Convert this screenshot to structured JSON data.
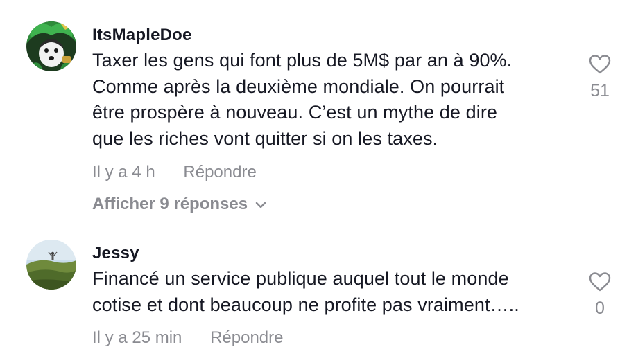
{
  "comments": [
    {
      "username": "ItsMapleDoe",
      "text_lines": [
        "Taxer les gens qui font plus de 5M$ par an à 90%.",
        "Comme après la deuxième mondiale. On pourrait",
        "être prospère à nouveau. C’est un mythe de dire",
        "que les riches vont quitter si on les taxes."
      ],
      "time": "Il y a 4 h",
      "reply_label": "Répondre",
      "view_replies_label": "Afficher 9 réponses",
      "like_count": "51"
    },
    {
      "username": "Jessy",
      "text_lines": [
        "Financé un service publique auquel tout le monde",
        "cotise et dont beaucoup ne profite pas vraiment….."
      ],
      "time": "Il y a 25 min",
      "reply_label": "Répondre",
      "like_count": "0"
    }
  ],
  "icons": {
    "like": "heart-outline-icon",
    "expand": "chevron-down-icon"
  },
  "colors": {
    "text": "#161823",
    "secondary": "#8a8b91"
  }
}
